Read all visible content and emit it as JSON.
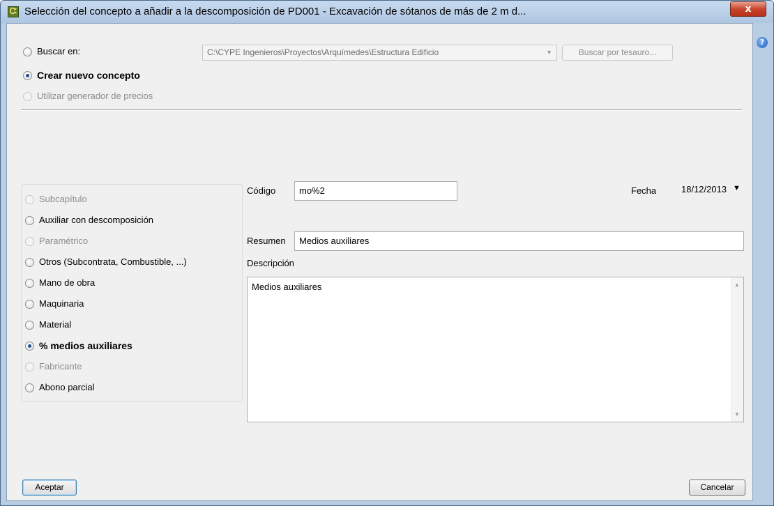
{
  "window": {
    "title": "Selección del concepto a añadir a la descomposición de PD001 - Excavación de sótanos de más de 2 m d...",
    "app_icon_glyph": "Ꮸ",
    "close_glyph": "x",
    "help_glyph": "?"
  },
  "search": {
    "buscar_label": "Buscar en:",
    "path_value": "C:\\CYPE Ingenieros\\Proyectos\\Arquímedes\\Estructura Edificio",
    "tesauro_button": "Buscar por tesauro...",
    "crear_label": "Crear nuevo concepto",
    "generador_label": "Utilizar generador de precios"
  },
  "types": [
    {
      "label": "Subcapítulo",
      "state": "disabled"
    },
    {
      "label": "Auxiliar con descomposición",
      "state": "enabled"
    },
    {
      "label": "Paramétrico",
      "state": "disabled"
    },
    {
      "label": "Otros (Subcontrata, Combustible, ...)",
      "state": "enabled"
    },
    {
      "label": "Mano de obra",
      "state": "enabled"
    },
    {
      "label": "Maquinaria",
      "state": "enabled"
    },
    {
      "label": "Material",
      "state": "enabled"
    },
    {
      "label": "% medios auxiliares",
      "state": "selected"
    },
    {
      "label": "Fabricante",
      "state": "disabled"
    },
    {
      "label": "Abono parcial",
      "state": "enabled"
    }
  ],
  "form": {
    "codigo_label": "Código",
    "codigo_value": "mo%2",
    "fecha_label": "Fecha",
    "fecha_value": "18/12/2013",
    "resumen_label": "Resumen",
    "resumen_value": "Medios auxiliares",
    "descripcion_label": "Descripción",
    "descripcion_value": "Medios auxiliares"
  },
  "footer": {
    "accept_label": "Aceptar",
    "cancel_label": "Cancelar"
  },
  "colors": {
    "frame": "#b9cde3",
    "client": "#f0f0f0",
    "close": "#c9452e",
    "radio_dot": "#1f4f96"
  }
}
